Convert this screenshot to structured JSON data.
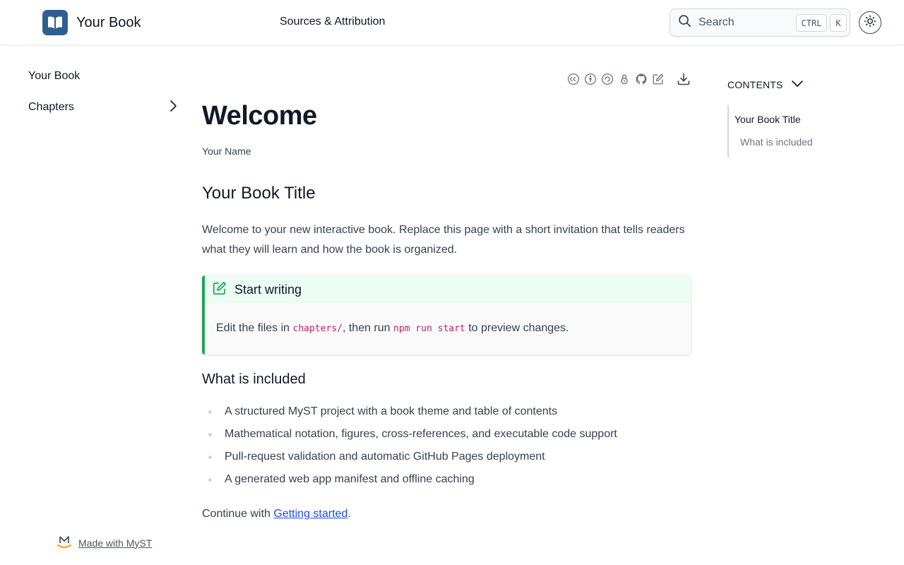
{
  "header": {
    "brand": "Your Book",
    "nav_link": "Sources & Attribution",
    "search_label": "Search",
    "shortcut_ctrl": "CTRL",
    "shortcut_k": "K"
  },
  "sidebar": {
    "items": [
      {
        "label": "Your Book"
      },
      {
        "label": "Chapters"
      }
    ],
    "footer": "Made with MyST"
  },
  "toolbar": {
    "icons": [
      "cc-icon",
      "by-icon",
      "sa-icon",
      "open-access-icon",
      "github-icon",
      "edit-icon",
      "download-icon"
    ]
  },
  "article": {
    "title": "Welcome",
    "author": "Your Name",
    "heading": "Your Book Title",
    "intro": "Welcome to your new interactive book. Replace this page with a short invitation that tells readers what they will learn and how the book is organized.",
    "admonition": {
      "title": "Start writing",
      "text_1": "Edit the files in ",
      "code_1": "chapters/",
      "text_2": ", then run ",
      "code_2": "npm run start",
      "text_3": " to preview changes."
    },
    "subheading": "What is included",
    "bullets": [
      "A structured MyST project with a book theme and table of contents",
      "Mathematical notation, figures, cross-references, and executable code support",
      "Pull-request validation and automatic GitHub Pages deployment",
      "A generated web app manifest and offline caching"
    ],
    "continue_prefix": "Continue with ",
    "continue_link": "Getting started",
    "continue_suffix": "."
  },
  "toc": {
    "heading": "CONTENTS",
    "items": [
      {
        "label": "Your Book Title"
      },
      {
        "label": "What is included"
      }
    ]
  },
  "colors": {
    "brand": "#2f5f8f",
    "admonition_accent": "#22a55a",
    "link": "#1d4ed8",
    "code": "#b3246b"
  }
}
